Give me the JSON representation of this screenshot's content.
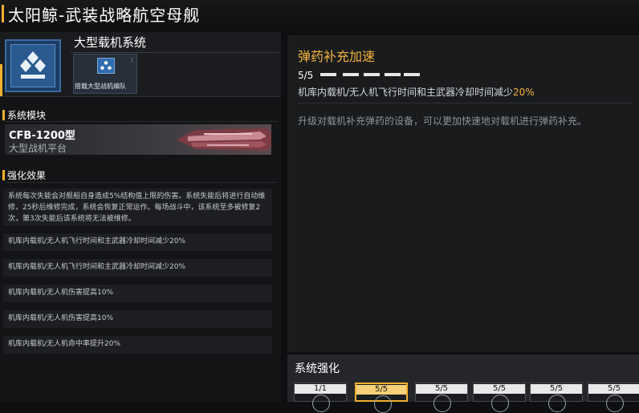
{
  "header": {
    "title": "太阳鲸-武装战略航空母舰"
  },
  "system": {
    "name": "大型载机系统",
    "sub_card_label": "搭载大型战机编队",
    "sub_card_icon": "triangle-formation-icon"
  },
  "module_section": {
    "title": "系统模块",
    "module_name": "CFB-1200型",
    "module_type": "大型战机平台"
  },
  "effects_section": {
    "title": "强化效果",
    "items": [
      "系统每次失能会对舰船自身造成5%结构值上限的伤害。系统失能后将进行自动维修，25秒后维修完成，系统会恢复正常运作。每场战斗中，该系统至多被修复2次，第3次失能后该系统将无法被维修。",
      "机库内载机/无人机飞行时间和主武器冷却时间减少20%",
      "机库内载机/无人机飞行时间和主武器冷却时间减少20%",
      "机库内载机/无人机伤害提高10%",
      "机库内载机/无人机伤害提高10%",
      "机库内载机/无人机命中率提升20%"
    ]
  },
  "upgrade": {
    "title": "弹药补充加速",
    "level": "5/5",
    "level_current": 5,
    "level_max": 5,
    "effect_text": "机库内载机/无人机飞行时间和主武器冷却时间减少",
    "effect_value": "20%",
    "description": "升级对载机补充弹药的设备，可以更加快速地对载机进行弹药补充。"
  },
  "enhance": {
    "title": "系统强化",
    "slots": [
      "1/1",
      "5/5",
      "5/5",
      "5/5",
      "5/5",
      "5/5"
    ],
    "selected_index": 1
  },
  "colors": {
    "accent": "#f0b030",
    "highlight_text": "#f2b33d",
    "icon_blue": "#2a5a8f"
  }
}
